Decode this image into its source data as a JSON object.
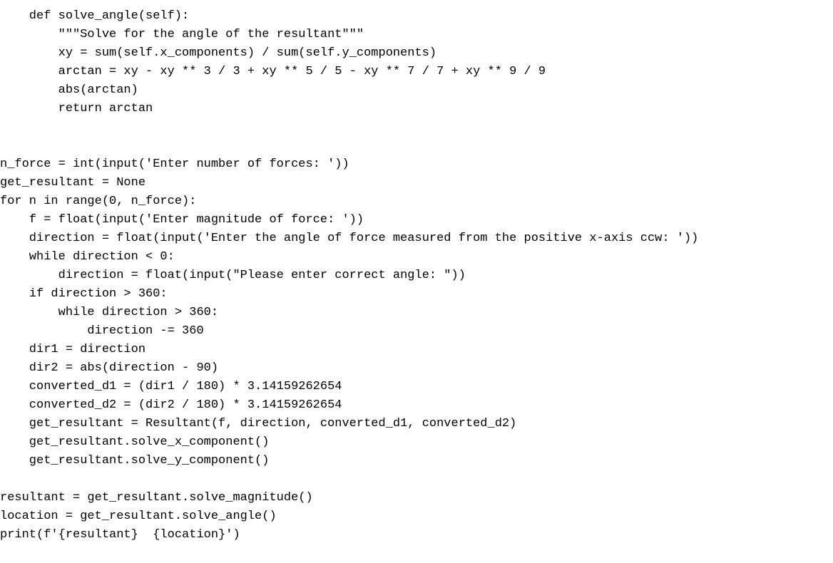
{
  "code": {
    "lines": [
      "    def solve_angle(self):",
      "        \"\"\"Solve for the angle of the resultant\"\"\"",
      "        xy = sum(self.x_components) / sum(self.y_components)",
      "        arctan = xy - xy ** 3 / 3 + xy ** 5 / 5 - xy ** 7 / 7 + xy ** 9 / 9",
      "        abs(arctan)",
      "        return arctan",
      "",
      "",
      "n_force = int(input('Enter number of forces: '))",
      "get_resultant = None",
      "for n in range(0, n_force):",
      "    f = float(input('Enter magnitude of force: '))",
      "    direction = float(input('Enter the angle of force measured from the positive x-axis ccw: '))",
      "    while direction < 0:",
      "        direction = float(input(\"Please enter correct angle: \"))",
      "    if direction > 360:",
      "        while direction > 360:",
      "            direction -= 360",
      "    dir1 = direction",
      "    dir2 = abs(direction - 90)",
      "    converted_d1 = (dir1 / 180) * 3.14159262654",
      "    converted_d2 = (dir2 / 180) * 3.14159262654",
      "    get_resultant = Resultant(f, direction, converted_d1, converted_d2)",
      "    get_resultant.solve_x_component()",
      "    get_resultant.solve_y_component()",
      "",
      "resultant = get_resultant.solve_magnitude()",
      "location = get_resultant.solve_angle()",
      "print(f'{resultant}  {location}')"
    ]
  }
}
